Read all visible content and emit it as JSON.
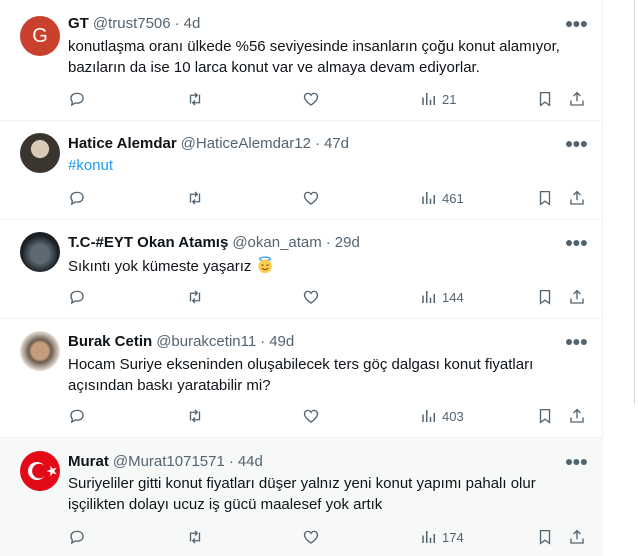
{
  "tweets": [
    {
      "name": "GT",
      "handle": "@trust7506",
      "time": "4d",
      "avatar_letter": "G",
      "avatar_color": "#c9402c",
      "lines": [
        "konutlaşma oranı ülkede %56 seviyesinde insanların çoğu konut alamıyor,",
        "bazıların da ise 10 larca konut var ve almaya devam ediyorlar."
      ],
      "views": "21"
    },
    {
      "name": "Hatice Alemdar",
      "handle": "@HaticeAlemdar12",
      "time": "47d",
      "lines": [
        "#konut"
      ],
      "views": "461"
    },
    {
      "name": "T.C-#EYT Okan Atamış",
      "handle": "@okan_atam",
      "time": "29d",
      "lines": [
        "Sıkıntı yok kümeste yaşarız"
      ],
      "emoji": "smiling-face-with-halo",
      "views": "144"
    },
    {
      "name": "Burak Cetin",
      "handle": "@burakcetin11",
      "time": "49d",
      "lines": [
        "Hocam Suriye ekseninden oluşabilecek ters göç dalgası konut fiyatları",
        "açısından baskı yaratabilir mi?"
      ],
      "views": "403"
    },
    {
      "name": "Murat",
      "handle": "@Murat1071571",
      "time": "44d",
      "lines": [
        "Suriyeliler gitti konut fiyatları düşer yalnız yeni konut yapımı pahalı olur",
        "işçilikten dolayı ucuz iş gücü maalesef yok artık"
      ],
      "views": "174"
    }
  ],
  "icons": {
    "more": "more-horizontal-icon",
    "reply": "reply-icon",
    "retweet": "retweet-icon",
    "like": "heart-icon",
    "views": "views-chart-icon",
    "bookmark": "bookmark-icon",
    "share": "share-icon"
  },
  "colors": {
    "text": "#0f1419",
    "muted": "#536471",
    "link": "#1d9bf0",
    "divider": "#eff3f4",
    "highlight_bg": "#f7f9f9"
  }
}
